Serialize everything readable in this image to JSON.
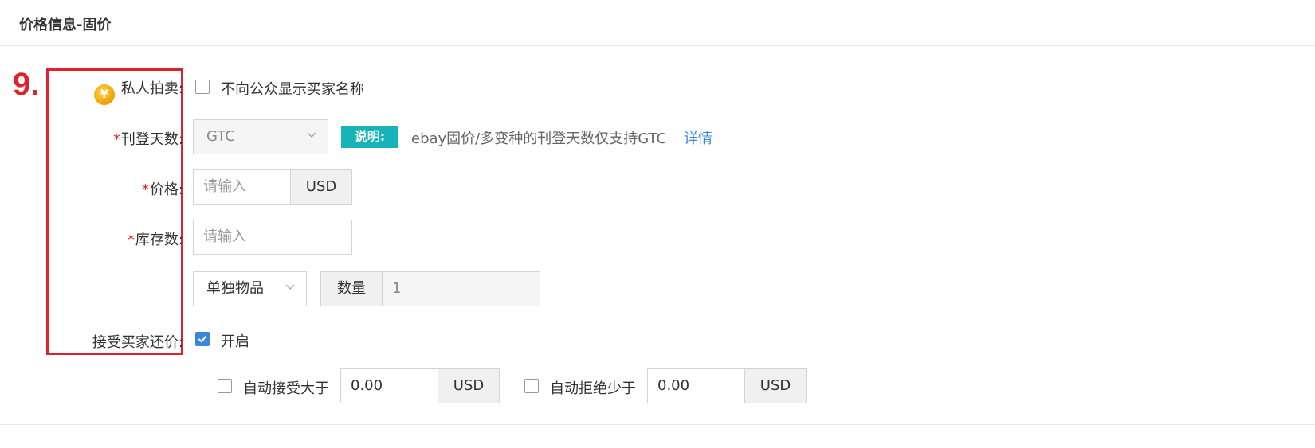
{
  "section": {
    "title": "价格信息-固价"
  },
  "annotation": {
    "step": "9."
  },
  "private_auction": {
    "label": "私人拍卖:",
    "option": "不向公众显示买家名称",
    "checked": false
  },
  "listing_days": {
    "required_mark": "*",
    "label": "刊登天数:",
    "value": "GTC",
    "badge": "说明:",
    "note": "ebay固价/多变种的刊登天数仅支持GTC",
    "link": "详情"
  },
  "price": {
    "required_mark": "*",
    "label": "价格:",
    "placeholder": "请输入",
    "currency": "USD"
  },
  "stock": {
    "required_mark": "*",
    "label": "库存数:",
    "placeholder": "请输入"
  },
  "quantity": {
    "type_value": "单独物品",
    "qty_label": "数量",
    "qty_value": "1"
  },
  "best_offer": {
    "label": "接受买家还价:",
    "option": "开启",
    "checked": true,
    "auto_accept": {
      "label": "自动接受大于",
      "value": "0.00",
      "currency": "USD",
      "checked": false
    },
    "auto_decline": {
      "label": "自动拒绝少于",
      "value": "0.00",
      "currency": "USD",
      "checked": false
    }
  },
  "colors": {
    "accent": "#3a86d9",
    "badge": "#16b3b8",
    "required": "#e0202a",
    "annotation": "#e0202a"
  }
}
